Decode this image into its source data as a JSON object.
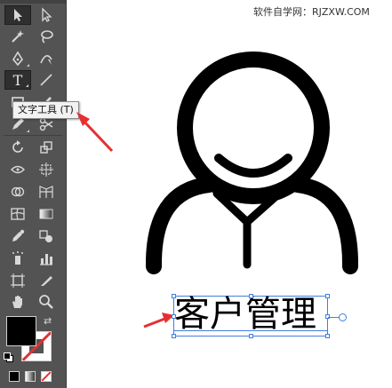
{
  "watermark": "软件自学网：RJZXW.COM",
  "tooltip": "文字工具 (T)",
  "canvas": {
    "text": "客户管理"
  },
  "tools": [
    {
      "name": "selection-tool",
      "icon": "arrow-icon"
    },
    {
      "name": "direct-selection-tool",
      "icon": "white-arrow-icon"
    },
    {
      "name": "magic-wand-tool",
      "icon": "wand-icon"
    },
    {
      "name": "lasso-tool",
      "icon": "lasso-icon"
    },
    {
      "name": "pen-tool",
      "icon": "pen-icon"
    },
    {
      "name": "curvature-tool",
      "icon": "curvature-icon"
    },
    {
      "name": "type-tool",
      "icon": "type-icon",
      "label": "T"
    },
    {
      "name": "line-tool",
      "icon": "line-icon"
    }
  ],
  "colors": {
    "fill": "#000000",
    "stroke": "#ffffff",
    "accent": "#3f7fe0",
    "arrow": "#e53030",
    "toolbar": "#535353"
  }
}
